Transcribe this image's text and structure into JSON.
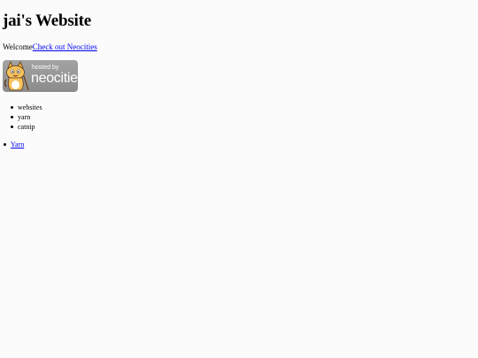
{
  "page": {
    "title": "jai's Website",
    "welcome_text": "Welcome",
    "neocities_link": "Check out Neocities",
    "badge": {
      "hosted_by": "hosted by",
      "brand": "neocities"
    },
    "things": [
      {
        "label": "websites"
      },
      {
        "label": "yarn"
      },
      {
        "label": "catnip"
      }
    ],
    "links": [
      {
        "label": "Yarn"
      }
    ]
  },
  "colors": {
    "background": "#fbfbfb",
    "link": "#0000ee",
    "badge": "#979797"
  }
}
